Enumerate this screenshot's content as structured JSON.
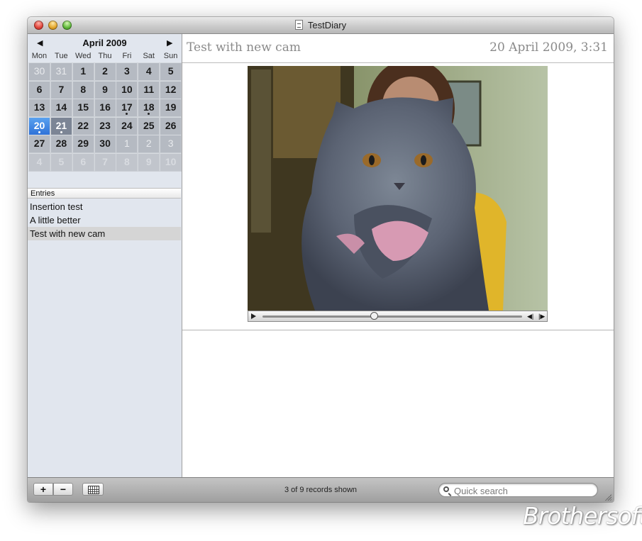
{
  "window": {
    "title": "TestDiary"
  },
  "calendar": {
    "month_label": "April 2009",
    "prev_arrow": "◀",
    "next_arrow": "▶",
    "weekdays": [
      "Mon",
      "Tue",
      "Wed",
      "Thu",
      "Fri",
      "Sat",
      "Sun"
    ],
    "weeks": [
      [
        "30",
        "31",
        "1",
        "2",
        "3",
        "4",
        "5"
      ],
      [
        "6",
        "7",
        "8",
        "9",
        "10",
        "11",
        "12"
      ],
      [
        "13",
        "14",
        "15",
        "16",
        "17",
        "18",
        "19"
      ],
      [
        "20",
        "21",
        "22",
        "23",
        "24",
        "25",
        "26"
      ],
      [
        "27",
        "28",
        "29",
        "30",
        "1",
        "2",
        "3"
      ],
      [
        "4",
        "5",
        "6",
        "7",
        "8",
        "9",
        "10"
      ]
    ],
    "today": "20",
    "selected": "21",
    "days_with_entries": [
      "17",
      "18",
      "20",
      "21"
    ]
  },
  "entries": {
    "header": "Entries",
    "items": [
      "Insertion test",
      "A little better",
      "Test with new cam"
    ],
    "selected_index": 2
  },
  "entry": {
    "title": "Test with new cam",
    "date": "20 April 2009, 3:31",
    "media": {
      "position_fraction": 0.43
    }
  },
  "bottombar": {
    "add_label": "+",
    "remove_label": "−",
    "status": "3 of 9 records shown",
    "search_placeholder": "Quick search"
  },
  "watermark": "Brothersoft"
}
